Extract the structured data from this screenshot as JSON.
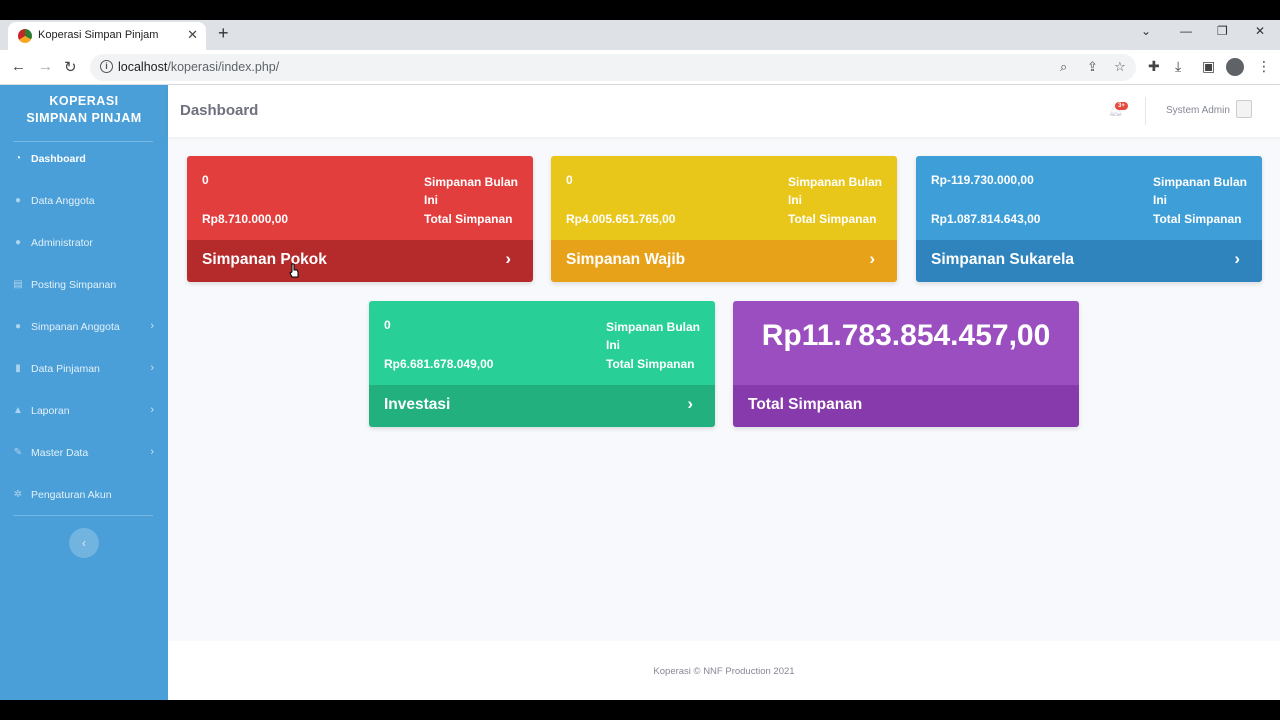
{
  "browser": {
    "tab_title": "Koperasi Simpan Pinjam",
    "tab_close": "✕",
    "new_tab": "+",
    "url_host": "localhost",
    "url_path": "/koperasi/index.php/"
  },
  "sidebar": {
    "brand_line1": "KOPERASI",
    "brand_line2": "SIMPNAN PINJAM",
    "items": [
      {
        "label": "Dashboard",
        "icon": "gauge-icon"
      },
      {
        "label": "Data Anggota",
        "icon": "users-icon"
      },
      {
        "label": "Administrator",
        "icon": "user-cog-icon"
      },
      {
        "label": "Posting Simpanan",
        "icon": "file-icon"
      },
      {
        "label": "Simpanan Anggota",
        "icon": "user-icon"
      },
      {
        "label": "Data Pinjaman",
        "icon": "document-icon"
      },
      {
        "label": "Laporan",
        "icon": "report-icon"
      },
      {
        "label": "Master Data",
        "icon": "wrench-icon"
      },
      {
        "label": "Pengaturan Akun",
        "icon": "cogs-icon"
      }
    ],
    "toggle": "‹"
  },
  "topbar": {
    "title": "Dashboard",
    "badge": "3+",
    "user_name": "System Admin"
  },
  "cards": {
    "pokok": {
      "v1": "0",
      "l1": "Simpanan Bulan Ini",
      "v2": "Rp8.710.000,00",
      "l2": "Total Simpanan",
      "title": "Simpanan Pokok",
      "arrow": "›"
    },
    "wajib": {
      "v1": "0",
      "l1": "Simpanan Bulan Ini",
      "v2": "Rp4.005.651.765,00",
      "l2": "Total Simpanan",
      "title": "Simpanan Wajib",
      "arrow": "›"
    },
    "sukarela": {
      "v1": "Rp-119.730.000,00",
      "l1": "Simpanan Bulan Ini",
      "v2": "Rp1.087.814.643,00",
      "l2": "Total Simpanan",
      "title": "Simpanan Sukarela",
      "arrow": "›"
    },
    "investasi": {
      "v1": "0",
      "l1": "Simpanan Bulan Ini",
      "v2": "Rp6.681.678.049,00",
      "l2": "Total Simpanan",
      "title": "Investasi",
      "arrow": "›"
    },
    "total": {
      "amount": "Rp11.783.854.457,00",
      "title": "Total Simpanan"
    }
  },
  "footer": {
    "text": "Koperasi © NNF Production 2021"
  },
  "colors": {
    "sidebar": "#4a9fd8",
    "pokok_body": "#e23e3e",
    "pokok_foot": "#b52a2a",
    "wajib_body": "#e8c61a",
    "wajib_foot": "#e8a21a",
    "sukarela_body": "#3d9ed8",
    "sukarela_foot": "#2f84bd",
    "investasi_body": "#28cf97",
    "investasi_foot": "#21b07e",
    "total_body": "#9b4ec0",
    "total_foot": "#863aab"
  }
}
